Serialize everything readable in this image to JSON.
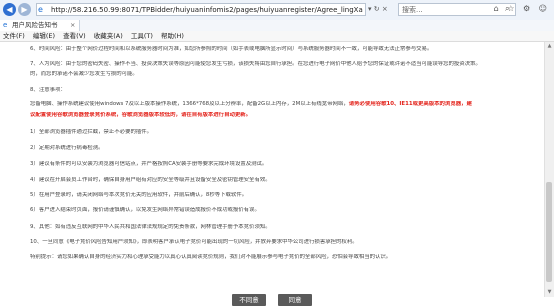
{
  "browser": {
    "url": "http://58.216.50.99:8071/TPBidder/huiyuaninfomis2/pages/huiyuanregister/Agree_lingXa",
    "url_tools": "▾ ↻ ×",
    "search_placeholder": "搜索...",
    "tab_title": "用户风险告知书",
    "tab_close": "×",
    "back_icon": "back-arrow",
    "forward_icon": "forward-arrow",
    "window_icons": "⌂ ☆ ⚙ ☺"
  },
  "menu": {
    "items": [
      "文件(F)",
      "编辑(E)",
      "查看(V)",
      "收藏夹(A)",
      "工具(T)",
      "帮助(H)"
    ]
  },
  "document": {
    "paragraphs": [
      "6、时间风险：由于整个网价过程时间和以系统服务器时间为准，如您所参照的时间（如手表或电脑所显示时间）与系统服务器时间不一致，可能导致无法正常参与交易。",
      "7、人为风险：由于您的密码失密、操作不当、投资决策失误等原因可能使您发生亏损，该损失将由您自行承担。在您进行电子网价中他人给予您的保证或许诺不适当可能误导您的投资决策。",
      "的，而您的承诺不会减少您发生亏损的可能。",
      "8、注意事项：",
      "您备电脑、操作系统建议使用windows 7及以上版本操作系统，1366*768及以上分辨率，配备2G以上内存，2M以上有线宽带网络，",
      "议配置使用谷歌浏览器登录竞价系统，谷歌浏览器版本较低的，请在自有版本进行自动更新。",
      "1）全部浏览器插件通过拦截，禁止不必要的插件。",
      "2）定期对系统进行病毒检测。",
      "3）建议有条件的可以安装为浏览器可信站点，并严格按照CA安装手册等要求完成环境设置及测试。",
      "4）建议在开启会员工作台时，确保自身用户组有对应的安全等级并且设备安全及密钥管理安全有效。",
      "5）在用户登录时，请关闭网络与本次竞价无关的应用软件，并前后确认，8秒等下载软件。",
      "6）客户进入结束时页面，报价请谨慎确认，以免发生网络异常错误造成报价不成功或报价有误。",
      "9、其他：如有违反互联网的中华人民共和国法律法规规定的免责条款，网林管理手册予本竞价须知。",
      "10、一旦同意《电子竞价风险告知用户须知》，即表明客户承认电子竞价可能出现的一切风险，并放弃要求中华公司进行损害承担的权利。",
      "特别提示：请您如果确认自身的经济实力和心理承受能力以真心认真阅读竞价规则，我们对不能展示参与电子竞价的全部风险，恐怕会导致相当的认识。"
    ],
    "red_tail_p5": "请务必使用谷歌10、IE11或更高版本的浏览器，建",
    "red_head_p6": "议配置使用谷歌浏览器登录竞价系统，谷歌浏览器版本较低的，请在自有版本进行自动更新。"
  },
  "buttons": {
    "disagree": "不同意",
    "agree": "同意"
  },
  "colors": {
    "warning_red": "#e3231b",
    "button_bg": "#5a5a5a"
  }
}
